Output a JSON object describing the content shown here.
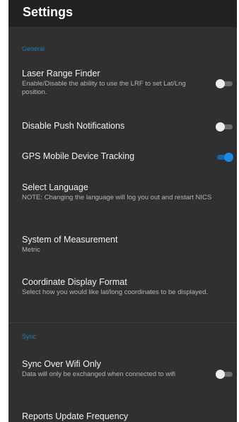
{
  "appbar": {
    "title": "Settings"
  },
  "sections": {
    "general": {
      "header": "General",
      "laser": {
        "title": "Laser Range Finder",
        "summary": "Enable/Disable the ability to use the LRF to set Lat/Lng position.",
        "enabled": false
      },
      "push": {
        "title": "Disable Push Notifications",
        "enabled": false
      },
      "gps": {
        "title": "GPS Mobile Device Tracking",
        "enabled": true
      },
      "language": {
        "title": "Select Language",
        "summary": "NOTE: Changing the language will log you out and restart NICS"
      },
      "measurement": {
        "title": "System of Measurement",
        "summary": "Metric"
      },
      "coordinate": {
        "title": "Coordinate Display Format",
        "summary": "Select how you would like lat/long coordinates to be displayed."
      }
    },
    "sync": {
      "header": "Sync",
      "wifi": {
        "title": "Sync Over Wifi Only",
        "summary": "Data will only be exchanged when connected to wifi",
        "enabled": false
      },
      "reports": {
        "title": "Reports Update Frequency"
      }
    }
  },
  "colors": {
    "background": "#303030",
    "appbar": "#212121",
    "accent": "#1e88e5",
    "category": "#1e7fb3"
  }
}
